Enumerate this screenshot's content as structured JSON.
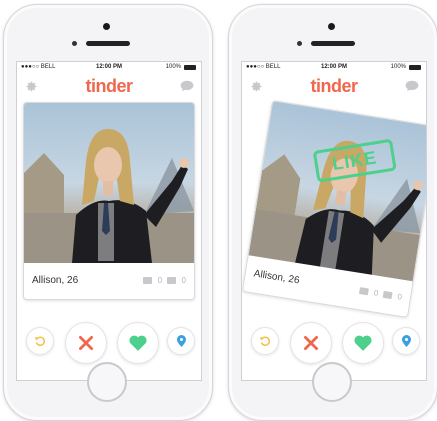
{
  "phones": [
    {
      "statusbar": {
        "carrier": "●●●○○ BELL",
        "time": "12:00 PM",
        "battery": "100%"
      },
      "appbar": {
        "logo": "tinder",
        "settings_icon": "gear-icon",
        "messages_icon": "chat-bubble-icon"
      },
      "card": {
        "name": "Allison, 26",
        "shared_friends": "0",
        "shared_interests": "0",
        "stamp": ""
      },
      "actions": [
        "rewind-icon",
        "nope-icon",
        "like-icon",
        "boost-icon"
      ]
    },
    {
      "statusbar": {
        "carrier": "●●●○○ BELL",
        "time": "12:00 PM",
        "battery": "100%"
      },
      "appbar": {
        "logo": "tinder",
        "settings_icon": "gear-icon",
        "messages_icon": "chat-bubble-icon"
      },
      "card": {
        "name": "Allison, 26",
        "shared_friends": "0",
        "shared_interests": "0",
        "stamp": "LIKE"
      },
      "actions": [
        "rewind-icon",
        "nope-icon",
        "like-icon",
        "boost-icon"
      ]
    }
  ],
  "colors": {
    "brand": "#f0674e",
    "like": "#4cd08b",
    "nope": "#f0674e",
    "rewind": "#f4c048",
    "boost": "#3aa0e4"
  }
}
